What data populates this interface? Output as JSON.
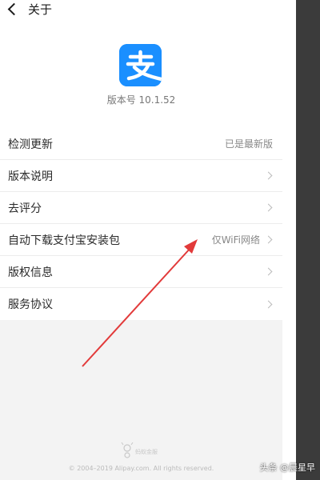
{
  "header": {
    "title": "关于",
    "back_icon": "chevron-left-icon"
  },
  "app": {
    "logo_glyph": "支",
    "version_text": "版本号 10.1.52",
    "brand_color": "#1a8fff"
  },
  "list": {
    "items": [
      {
        "label": "检测更新",
        "value": "已是最新版",
        "has_arrow": false
      },
      {
        "label": "版本说明",
        "value": "",
        "has_arrow": true
      },
      {
        "label": "去评分",
        "value": "",
        "has_arrow": true
      },
      {
        "label": "自动下载支付宝安装包",
        "value": "仅WiFi网络",
        "has_arrow": true
      },
      {
        "label": "版权信息",
        "value": "",
        "has_arrow": true
      },
      {
        "label": "服务协议",
        "value": "",
        "has_arrow": true
      }
    ]
  },
  "footer": {
    "logo_text": "蚂蚁金服",
    "copyright": "© 2004–2019 Alipay.com. All rights reserved."
  },
  "watermark": "头条 @晨星早",
  "annotation": {
    "arrow_color": "#e23a3a"
  }
}
